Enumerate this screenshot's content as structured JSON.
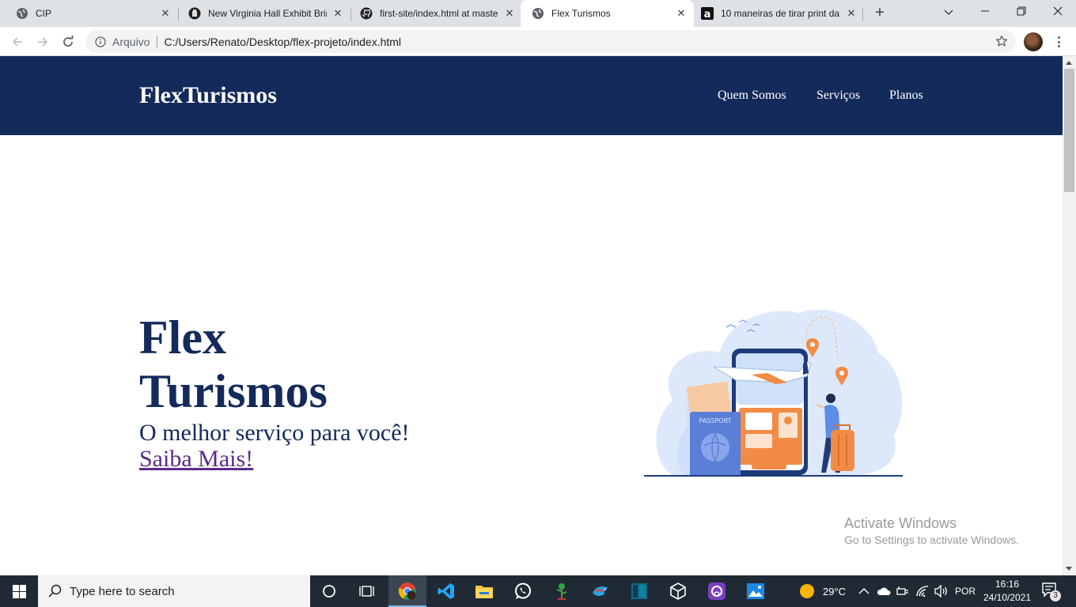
{
  "browser": {
    "tabs": [
      {
        "title": "CIP",
        "icon": "globe-icon"
      },
      {
        "title": "New Virginia Hall Exhibit Brin",
        "icon": "museum-icon"
      },
      {
        "title": "first-site/index.html at maste",
        "icon": "github-icon"
      },
      {
        "title": "Flex Turismos",
        "icon": "globe-icon",
        "active": true
      },
      {
        "title": "10 maneiras de tirar print da",
        "icon": "allthings-icon"
      }
    ],
    "address": {
      "scheme_label": "Arquivo",
      "url": "C:/Users/Renato/Desktop/flex-projeto/index.html"
    }
  },
  "site": {
    "brand": "FlexTurismos",
    "nav": [
      "Quem Somos",
      "Serviços",
      "Planos"
    ],
    "hero": {
      "title_line1": "Flex",
      "title_line2": "Turismos",
      "subtitle": "O melhor serviço para você!",
      "link": "Saiba Mais!"
    },
    "colors": {
      "header_bg": "#132a5a",
      "heading": "#132a5a",
      "link": "#5b2b8a",
      "accent_orange": "#f28b45"
    }
  },
  "os": {
    "watermark": {
      "title": "Activate Windows",
      "subtitle": "Go to Settings to activate Windows."
    },
    "taskbar": {
      "search_placeholder": "Type here to search",
      "weather": "29°C",
      "language": "POR",
      "time": "16:16",
      "date": "24/10/2021",
      "notifications": "3",
      "pinned": [
        "cortana-icon",
        "task-view-icon",
        "chrome-icon",
        "vscode-icon",
        "file-explorer-icon",
        "whatsapp-icon",
        "tree-app-icon",
        "edge-bird-icon",
        "terminal-icon",
        "virtualbox-icon",
        "github-desktop-icon",
        "photos-icon"
      ]
    }
  }
}
